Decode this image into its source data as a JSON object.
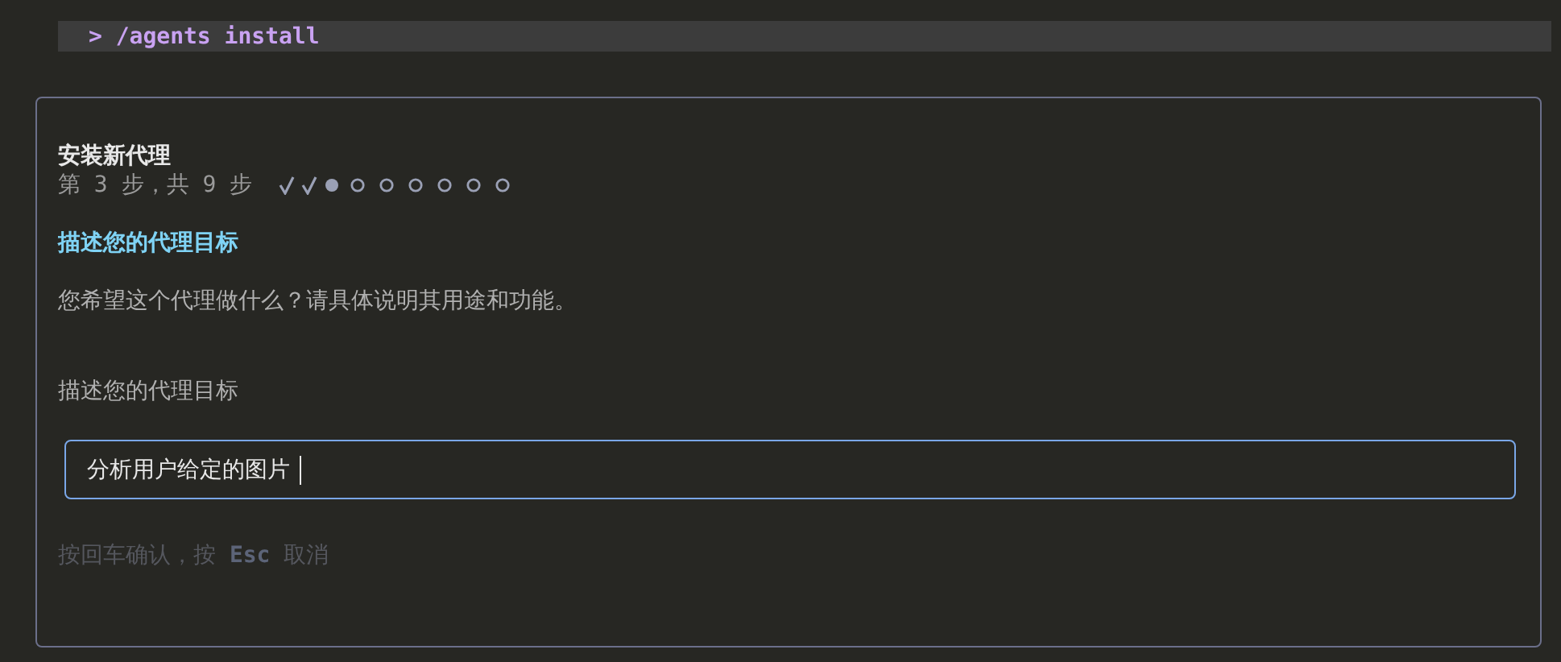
{
  "command": "> /agents install",
  "wizard": {
    "title": "安装新代理",
    "step_label": "第 3 步，共 9 步",
    "steps": [
      {
        "kind": "done"
      },
      {
        "kind": "done"
      },
      {
        "kind": "current"
      },
      {
        "kind": "pending"
      },
      {
        "kind": "pending"
      },
      {
        "kind": "pending"
      },
      {
        "kind": "pending"
      },
      {
        "kind": "pending"
      },
      {
        "kind": "pending"
      }
    ],
    "heading": "描述您的代理目标",
    "description": "您希望这个代理做什么？请具体说明其用途和功能。",
    "field": {
      "label": "描述您的代理目标",
      "value": "分析用户给定的图片",
      "focused": true
    },
    "hint": "按回车确认，按 **Esc** 取消"
  }
}
